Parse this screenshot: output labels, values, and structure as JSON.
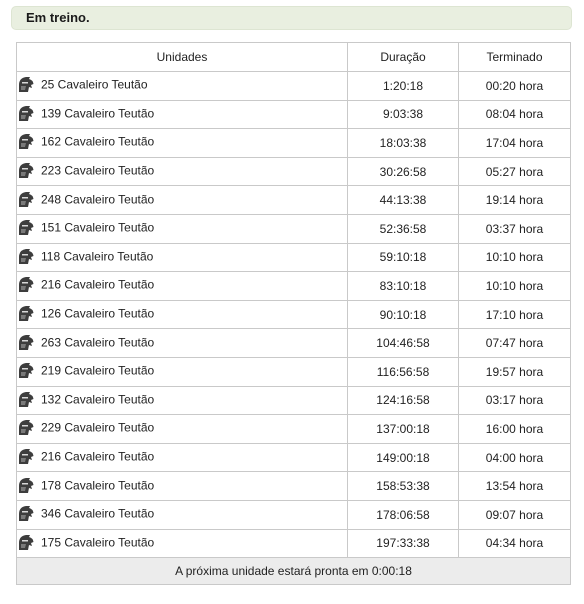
{
  "section_title": "Em treino.",
  "columns": {
    "units": "Unidades",
    "duration": "Duração",
    "finished": "Terminado"
  },
  "unit_icon": "knight-helmet-icon",
  "rows": [
    {
      "unit": "25 Cavaleiro Teutão",
      "duration": "1:20:18",
      "finished": "00:20 hora"
    },
    {
      "unit": "139 Cavaleiro Teutão",
      "duration": "9:03:38",
      "finished": "08:04 hora"
    },
    {
      "unit": "162 Cavaleiro Teutão",
      "duration": "18:03:38",
      "finished": "17:04 hora"
    },
    {
      "unit": "223 Cavaleiro Teutão",
      "duration": "30:26:58",
      "finished": "05:27 hora"
    },
    {
      "unit": "248 Cavaleiro Teutão",
      "duration": "44:13:38",
      "finished": "19:14 hora"
    },
    {
      "unit": "151 Cavaleiro Teutão",
      "duration": "52:36:58",
      "finished": "03:37 hora"
    },
    {
      "unit": "118 Cavaleiro Teutão",
      "duration": "59:10:18",
      "finished": "10:10 hora"
    },
    {
      "unit": "216 Cavaleiro Teutão",
      "duration": "83:10:18",
      "finished": "10:10 hora"
    },
    {
      "unit": "126 Cavaleiro Teutão",
      "duration": "90:10:18",
      "finished": "17:10 hora"
    },
    {
      "unit": "263 Cavaleiro Teutão",
      "duration": "104:46:58",
      "finished": "07:47 hora"
    },
    {
      "unit": "219 Cavaleiro Teutão",
      "duration": "116:56:58",
      "finished": "19:57 hora"
    },
    {
      "unit": "132 Cavaleiro Teutão",
      "duration": "124:16:58",
      "finished": "03:17 hora"
    },
    {
      "unit": "229 Cavaleiro Teutão",
      "duration": "137:00:18",
      "finished": "16:00 hora"
    },
    {
      "unit": "216 Cavaleiro Teutão",
      "duration": "149:00:18",
      "finished": "04:00 hora"
    },
    {
      "unit": "178 Cavaleiro Teutão",
      "duration": "158:53:38",
      "finished": "13:54 hora"
    },
    {
      "unit": "346 Cavaleiro Teutão",
      "duration": "178:06:58",
      "finished": "09:07 hora"
    },
    {
      "unit": "175 Cavaleiro Teutão",
      "duration": "197:33:38",
      "finished": "04:34 hora"
    }
  ],
  "footer": "A próxima unidade estará pronta em 0:00:18"
}
